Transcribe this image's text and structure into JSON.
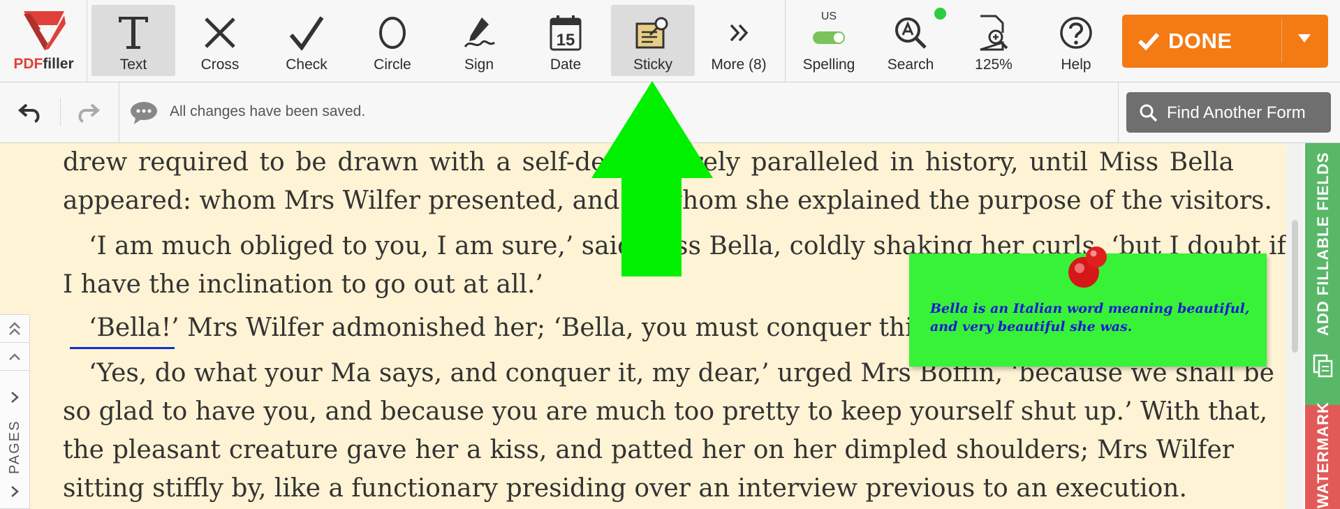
{
  "app": {
    "logo_text_red": "PDF",
    "logo_text_dark": "filler"
  },
  "toolbar": {
    "tools": [
      {
        "label": "Text",
        "icon": "text-icon"
      },
      {
        "label": "Cross",
        "icon": "cross-icon"
      },
      {
        "label": "Check",
        "icon": "check-icon"
      },
      {
        "label": "Circle",
        "icon": "circle-icon"
      },
      {
        "label": "Sign",
        "icon": "sign-icon"
      },
      {
        "label": "Date",
        "icon": "calendar-icon",
        "icon_text": "15"
      },
      {
        "label": "Sticky",
        "icon": "sticky-note-icon"
      },
      {
        "label": "More (8)",
        "icon": "double-chevron-icon"
      }
    ],
    "active_tools": [
      "Text",
      "Sticky"
    ],
    "spelling": {
      "label": "Spelling",
      "lang": "US",
      "enabled": true
    },
    "search_label": "Search",
    "zoom_label": "125%",
    "help_label": "Help",
    "done_label": "DONE"
  },
  "secondary_bar": {
    "status_text": "All changes have been saved.",
    "find_label": "Find Another Form"
  },
  "document": {
    "paragraphs": [
      {
        "lines": [
          "drew required to be drawn with a self-denial rarely paralleled in history, until Miss Bella",
          "appeared: whom Mrs Wilfer presented, and to whom she explained the purpose of the visitors."
        ]
      },
      {
        "lines": [
          "‘I am much obliged to you, I am sure,’ said Miss Bella, coldly shaking her curls, ‘but I doubt if",
          "I have the inclination to go out at all.’"
        ]
      },
      {
        "lines": [
          "‘Bella!’ Mrs Wilfer admonished her; ‘Bella, you must conquer this.’"
        ]
      },
      {
        "lines": [
          "‘Yes, do what your Ma says, and conquer it, my dear,’ urged Mrs Boffin, ‘because we shall be",
          "so glad to have you, and because you are much too pretty to keep yourself shut up.’ With that,",
          "the pleasant creature gave her a kiss, and patted her on her dimpled shoulders; Mrs Wilfer",
          "sitting stiffly by, like a functionary presiding over an interview previous to an execution."
        ]
      }
    ],
    "sticky_note": "Bella is an Italian word meaning beautiful, and very beautiful she was."
  },
  "sidebar": {
    "pages_label": "PAGES",
    "right_tabs": [
      {
        "label": "ADD FILLABLE FIELDS",
        "color": "#58b868"
      },
      {
        "label": "WATERMARK",
        "color": "#e25a58"
      }
    ]
  },
  "colors": {
    "accent": "#f47a14",
    "doc_bg": "#fef3d4",
    "sticky": "#38f238",
    "arrow": "#00f000"
  }
}
